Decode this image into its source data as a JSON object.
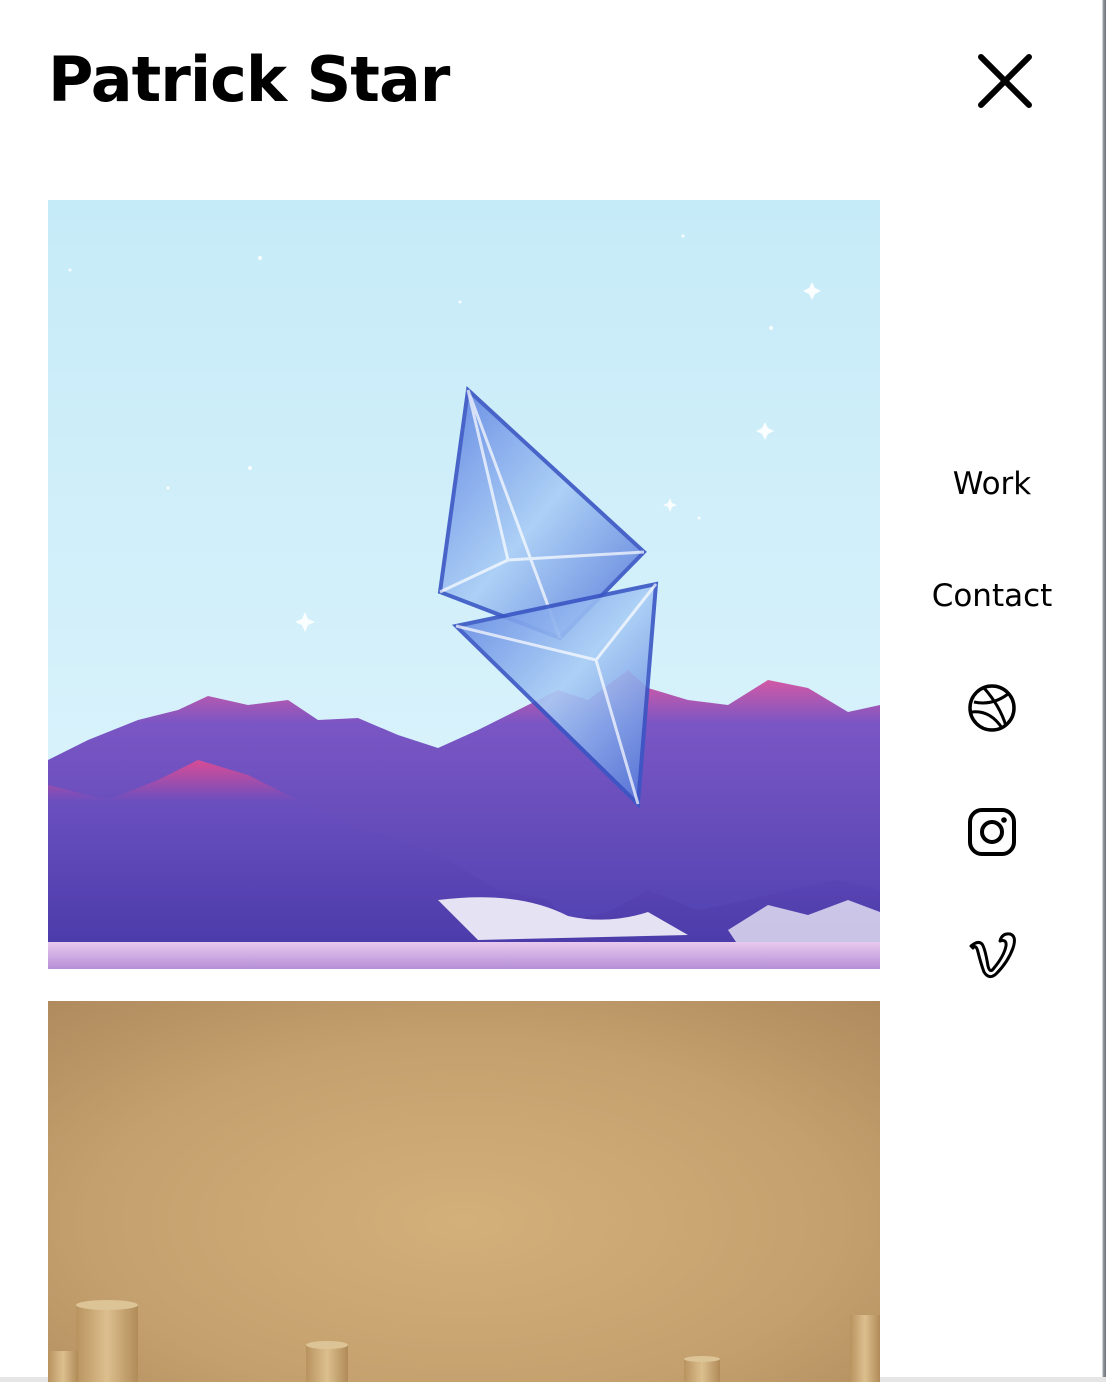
{
  "header": {
    "title": "Patrick Star",
    "close_icon": "close-icon"
  },
  "gallery": {
    "items": [
      {
        "name": "artwork-crystal-mountains",
        "palette": [
          "#c9ecf8",
          "#5b4fb8",
          "#e0509a",
          "#8fb6f2"
        ]
      },
      {
        "name": "artwork-golden-room",
        "palette": [
          "#b89463",
          "#caa878",
          "#d9b98c"
        ]
      }
    ]
  },
  "nav": {
    "items": [
      {
        "label": "Work"
      },
      {
        "label": "Contact"
      }
    ],
    "socials": [
      {
        "icon": "dribbble-icon"
      },
      {
        "icon": "instagram-icon"
      },
      {
        "icon": "vimeo-icon"
      }
    ]
  },
  "colors": {
    "text": "#000000",
    "background": "#ffffff"
  }
}
